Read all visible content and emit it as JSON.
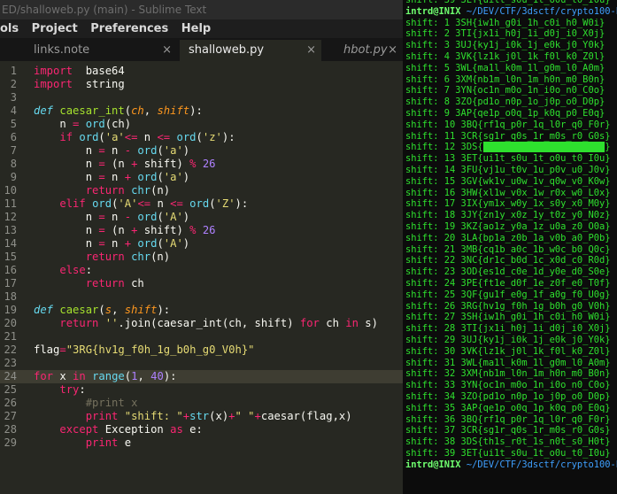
{
  "window": {
    "title": "ED/shalloweb.py (main) - Sublime Text"
  },
  "menu": [
    "ols",
    "Project",
    "Preferences",
    "Help"
  ],
  "tabs": [
    {
      "label": "links.note",
      "active": false,
      "italic": false
    },
    {
      "label": "shalloweb.py",
      "active": true,
      "italic": false
    },
    {
      "label": "hbot.py",
      "active": false,
      "italic": true
    }
  ],
  "tab_close_glyph": "×",
  "editor": {
    "current_line": 24,
    "lines": [
      {
        "n": "1",
        "t": [
          [
            "k",
            "import"
          ],
          [
            "",
            "  base64"
          ]
        ]
      },
      {
        "n": "2",
        "t": [
          [
            "k",
            "import"
          ],
          [
            "",
            "  string"
          ]
        ]
      },
      {
        "n": "3",
        "t": []
      },
      {
        "n": "4",
        "t": [
          [
            "sk",
            "def"
          ],
          [
            "",
            " "
          ],
          [
            "f",
            "caesar_int"
          ],
          [
            "",
            "("
          ],
          [
            "p",
            "ch"
          ],
          [
            "",
            ", "
          ],
          [
            "p",
            "shift"
          ],
          [
            "",
            "):"
          ]
        ]
      },
      {
        "n": "5",
        "t": [
          [
            "",
            "    n "
          ],
          [
            "k",
            "="
          ],
          [
            "",
            " "
          ],
          [
            "b",
            "ord"
          ],
          [
            "",
            "(ch)"
          ]
        ]
      },
      {
        "n": "6",
        "t": [
          [
            "",
            "    "
          ],
          [
            "k",
            "if"
          ],
          [
            "",
            " "
          ],
          [
            "b",
            "ord"
          ],
          [
            "",
            "("
          ],
          [
            "s",
            "'a'"
          ],
          [
            ") "
          ],
          [
            "k",
            "<="
          ],
          [
            "",
            " n "
          ],
          [
            "k",
            "<="
          ],
          [
            "",
            " "
          ],
          [
            "b",
            "ord"
          ],
          [
            "",
            "("
          ],
          [
            "s",
            "'z'"
          ],
          [
            "",
            "):"
          ]
        ]
      },
      {
        "n": "7",
        "t": [
          [
            "",
            "        n "
          ],
          [
            "k",
            "="
          ],
          [
            "",
            " n "
          ],
          [
            "k",
            "-"
          ],
          [
            "",
            " "
          ],
          [
            "b",
            "ord"
          ],
          [
            "",
            "("
          ],
          [
            "s",
            "'a'"
          ],
          [
            "",
            ")"
          ]
        ]
      },
      {
        "n": "8",
        "t": [
          [
            "",
            "        n "
          ],
          [
            "k",
            "="
          ],
          [
            "",
            " (n "
          ],
          [
            "k",
            "+"
          ],
          [
            "",
            " shift) "
          ],
          [
            "k",
            "%"
          ],
          [
            "",
            " "
          ],
          [
            "n",
            "26"
          ]
        ]
      },
      {
        "n": "9",
        "t": [
          [
            "",
            "        n "
          ],
          [
            "k",
            "="
          ],
          [
            "",
            " n "
          ],
          [
            "k",
            "+"
          ],
          [
            "",
            " "
          ],
          [
            "b",
            "ord"
          ],
          [
            "",
            "("
          ],
          [
            "s",
            "'a'"
          ],
          [
            "",
            ")"
          ]
        ]
      },
      {
        "n": "10",
        "t": [
          [
            "",
            "        "
          ],
          [
            "k",
            "return"
          ],
          [
            "",
            " "
          ],
          [
            "b",
            "chr"
          ],
          [
            "",
            "(n)"
          ]
        ]
      },
      {
        "n": "11",
        "t": [
          [
            "",
            "    "
          ],
          [
            "k",
            "elif"
          ],
          [
            "",
            " "
          ],
          [
            "b",
            "ord"
          ],
          [
            "",
            "("
          ],
          [
            "s",
            "'A'"
          ],
          [
            ") "
          ],
          [
            "k",
            "<="
          ],
          [
            "",
            " n "
          ],
          [
            "k",
            "<="
          ],
          [
            "",
            " "
          ],
          [
            "b",
            "ord"
          ],
          [
            "",
            "("
          ],
          [
            "s",
            "'Z'"
          ],
          [
            "",
            "):"
          ]
        ]
      },
      {
        "n": "12",
        "t": [
          [
            "",
            "        n "
          ],
          [
            "k",
            "="
          ],
          [
            "",
            " n "
          ],
          [
            "k",
            "-"
          ],
          [
            "",
            " "
          ],
          [
            "b",
            "ord"
          ],
          [
            "",
            "("
          ],
          [
            "s",
            "'A'"
          ],
          [
            "",
            ")"
          ]
        ]
      },
      {
        "n": "13",
        "t": [
          [
            "",
            "        n "
          ],
          [
            "k",
            "="
          ],
          [
            "",
            " (n "
          ],
          [
            "k",
            "+"
          ],
          [
            "",
            " shift) "
          ],
          [
            "k",
            "%"
          ],
          [
            "",
            " "
          ],
          [
            "n",
            "26"
          ]
        ]
      },
      {
        "n": "14",
        "t": [
          [
            "",
            "        n "
          ],
          [
            "k",
            "="
          ],
          [
            "",
            " n "
          ],
          [
            "k",
            "+"
          ],
          [
            "",
            " "
          ],
          [
            "b",
            "ord"
          ],
          [
            "",
            "("
          ],
          [
            "s",
            "'A'"
          ],
          [
            "",
            ")"
          ]
        ]
      },
      {
        "n": "15",
        "t": [
          [
            "",
            "        "
          ],
          [
            "k",
            "return"
          ],
          [
            "",
            " "
          ],
          [
            "b",
            "chr"
          ],
          [
            "",
            "(n)"
          ]
        ]
      },
      {
        "n": "16",
        "t": [
          [
            "",
            "    "
          ],
          [
            "k",
            "else"
          ],
          [
            "",
            ":"
          ]
        ]
      },
      {
        "n": "17",
        "t": [
          [
            "",
            "        "
          ],
          [
            "k",
            "return"
          ],
          [
            "",
            " ch"
          ]
        ]
      },
      {
        "n": "18",
        "t": []
      },
      {
        "n": "19",
        "t": [
          [
            "sk",
            "def"
          ],
          [
            "",
            " "
          ],
          [
            "f",
            "caesar"
          ],
          [
            "",
            "("
          ],
          [
            "p",
            "s"
          ],
          [
            "",
            ", "
          ],
          [
            "p",
            "shift"
          ],
          [
            "",
            "):"
          ]
        ]
      },
      {
        "n": "20",
        "t": [
          [
            "",
            "    "
          ],
          [
            "k",
            "return"
          ],
          [
            "",
            " "
          ],
          [
            "s",
            "''"
          ],
          [
            "",
            ".join(caesar_int(ch, shift) "
          ],
          [
            "k",
            "for"
          ],
          [
            "",
            " ch "
          ],
          [
            "k",
            "in"
          ],
          [
            "",
            " s)"
          ]
        ]
      },
      {
        "n": "21",
        "t": []
      },
      {
        "n": "22",
        "t": [
          [
            "",
            "flag"
          ],
          [
            "k",
            "="
          ],
          [
            "s",
            "\"3RG{hv1g_f0h_1g_b0h_g0_V0h}\""
          ]
        ]
      },
      {
        "n": "23",
        "t": []
      },
      {
        "n": "24",
        "t": [
          [
            "k",
            "for"
          ],
          [
            "",
            " x "
          ],
          [
            "k",
            "in"
          ],
          [
            "",
            " "
          ],
          [
            "b",
            "range"
          ],
          [
            "",
            "("
          ],
          [
            "n",
            "1"
          ],
          [
            "",
            ", "
          ],
          [
            "n",
            "40"
          ],
          [
            "",
            "):"
          ]
        ]
      },
      {
        "n": "25",
        "t": [
          [
            "",
            "    "
          ],
          [
            "k",
            "try"
          ],
          [
            "",
            ":"
          ]
        ]
      },
      {
        "n": "26",
        "t": [
          [
            "",
            "        "
          ],
          [
            "c",
            "#print x"
          ]
        ]
      },
      {
        "n": "27",
        "t": [
          [
            "",
            "        "
          ],
          [
            "k",
            "print"
          ],
          [
            "",
            " "
          ],
          [
            "s",
            "\"shift: \""
          ],
          [
            "k",
            "+"
          ],
          [
            "b",
            "str"
          ],
          [
            "",
            "(x)"
          ],
          [
            "k",
            "+"
          ],
          [
            "s",
            "\" \""
          ],
          [
            "k",
            "+"
          ],
          [
            "",
            "caesar(flag,x)"
          ]
        ]
      },
      {
        "n": "28",
        "t": [
          [
            "",
            "    "
          ],
          [
            "k",
            "except"
          ],
          [
            "",
            " Exception "
          ],
          [
            "k",
            "as"
          ],
          [
            "",
            " e:"
          ]
        ]
      },
      {
        "n": "29",
        "t": [
          [
            "",
            "        "
          ],
          [
            "k",
            "print"
          ],
          [
            "",
            " e"
          ]
        ]
      }
    ]
  },
  "terminal": {
    "top_partial": "shift: 39 3ET{uilt_s0u_1t_o0u_t0_I0u}",
    "prompt_user": "intrd@INIX",
    "prompt_path": " ~/DEV/CTF/3dsctf/crypto100-ho",
    "highlight_line": 12,
    "shifts": [
      "shift: 1 3SH{iw1h_g0i_1h_c0i_h0_W0i}",
      "shift: 2 3TI{jx1i_h0j_1i_d0j_i0_X0j}",
      "shift: 3 3UJ{ky1j_i0k_1j_e0k_j0_Y0k}",
      "shift: 4 3VK{lz1k_j0l_1k_f0l_k0_Z0l}",
      "shift: 5 3WL{ma1l_k0m_1l_g0m_l0_A0m}",
      "shift: 6 3XM{nb1m_l0n_1m_h0n_m0_B0n}",
      "shift: 7 3YN{oc1n_m0o_1n_i0o_n0_C0o}",
      "shift: 8 3ZO{pd1o_n0p_1o_j0p_o0_D0p}",
      "shift: 9 3AP{qe1p_o0q_1p_k0q_p0_E0q}",
      "shift: 10 3BQ{rf1q_p0r_1q_l0r_q0_F0r}",
      "shift: 11 3CR{sg1r_q0s_1r_m0s_r0_G0s}",
      "shift: 12 3DS{                      }",
      "shift: 13 3ET{ui1t_s0u_1t_o0u_t0_I0u}",
      "shift: 14 3FU{vj1u_t0v_1u_p0v_u0_J0v}",
      "shift: 15 3GV{wk1v_u0w_1v_q0w_v0_K0w}",
      "shift: 16 3HW{xl1w_v0x_1w_r0x_w0_L0x}",
      "shift: 17 3IX{ym1x_w0y_1x_s0y_x0_M0y}",
      "shift: 18 3JY{zn1y_x0z_1y_t0z_y0_N0z}",
      "shift: 19 3KZ{ao1z_y0a_1z_u0a_z0_O0a}",
      "shift: 20 3LA{bp1a_z0b_1a_v0b_a0_P0b}",
      "shift: 21 3MB{cq1b_a0c_1b_w0c_b0_Q0c}",
      "shift: 22 3NC{dr1c_b0d_1c_x0d_c0_R0d}",
      "shift: 23 3OD{es1d_c0e_1d_y0e_d0_S0e}",
      "shift: 24 3PE{ft1e_d0f_1e_z0f_e0_T0f}",
      "shift: 25 3QF{gu1f_e0g_1f_a0g_f0_U0g}",
      "shift: 26 3RG{hv1g_f0h_1g_b0h_g0_V0h}",
      "shift: 27 3SH{iw1h_g0i_1h_c0i_h0_W0i}",
      "shift: 28 3TI{jx1i_h0j_1i_d0j_i0_X0j}",
      "shift: 29 3UJ{ky1j_i0k_1j_e0k_j0_Y0k}",
      "shift: 30 3VK{lz1k_j0l_1k_f0l_k0_Z0l}",
      "shift: 31 3WL{ma1l_k0m_1l_g0m_l0_A0m}",
      "shift: 32 3XM{nb1m_l0n_1m_h0n_m0_B0n}",
      "shift: 33 3YN{oc1n_m0o_1n_i0o_n0_C0o}",
      "shift: 34 3ZO{pd1o_n0p_1o_j0p_o0_D0p}",
      "shift: 35 3AP{qe1p_o0q_1p_k0q_p0_E0q}",
      "shift: 36 3BQ{rf1q_p0r_1q_l0r_q0_F0r}",
      "shift: 37 3CR{sg1r_q0s_1r_m0s_r0_G0s}",
      "shift: 38 3DS{th1s_r0t_1s_n0t_s0_H0t}",
      "shift: 39 3ET{ui1t_s0u_1t_o0u_t0_I0u}"
    ]
  },
  "colors": {
    "editor_bg": "#272822",
    "terminal_bg": "#0c0c0c",
    "terminal_green": "#2ee02e",
    "prompt_path": "#3fa0ff"
  }
}
